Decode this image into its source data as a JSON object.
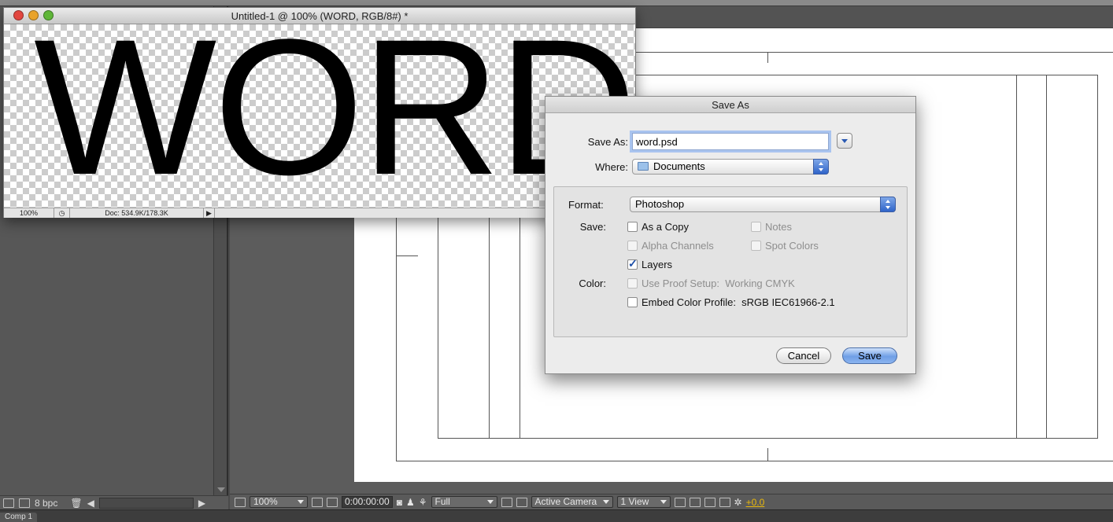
{
  "after_effects": {
    "left_bottom": {
      "bpc_label": "8 bpc"
    },
    "viewer_bottom": {
      "zoom": "100%",
      "timecode": "0:00:00:00",
      "resolution": "Full",
      "camera": "Active Camera",
      "views": "1 View",
      "exposure": "+0.0"
    },
    "footer_tab": "Comp 1"
  },
  "photoshop": {
    "window_title": "Untitled-1 @ 100% (WORD, RGB/8#) *",
    "canvas_text": "WORD",
    "status": {
      "zoom": "100%",
      "doc_info": "Doc: 534.9K/178.3K"
    }
  },
  "save_dialog": {
    "title": "Save As",
    "save_as_label": "Save As:",
    "filename": "word.psd",
    "where_label": "Where:",
    "where_value": "Documents",
    "format_label": "Format:",
    "format_value": "Photoshop",
    "save_label": "Save:",
    "color_label": "Color:",
    "options": {
      "as_a_copy": {
        "label": "As a Copy",
        "checked": false,
        "enabled": true
      },
      "notes": {
        "label": "Notes",
        "checked": false,
        "enabled": false
      },
      "alpha_channels": {
        "label": "Alpha Channels",
        "checked": false,
        "enabled": false
      },
      "spot_colors": {
        "label": "Spot Colors",
        "checked": false,
        "enabled": false
      },
      "layers": {
        "label": "Layers",
        "checked": true,
        "enabled": true
      },
      "use_proof_setup": {
        "label": "Use Proof Setup:  Working CMYK",
        "checked": false,
        "enabled": false
      },
      "embed_color_profile": {
        "label": "Embed Color Profile:  sRGB IEC61966-2.1",
        "checked": false,
        "enabled": true
      }
    },
    "buttons": {
      "cancel": "Cancel",
      "save": "Save"
    }
  },
  "colors": {
    "traffic_close": "#e2463f",
    "traffic_minimize": "#e9a32b",
    "traffic_zoom": "#5fb638",
    "default_button": "#6f9fe6",
    "exposure_text": "#e8b80c"
  }
}
